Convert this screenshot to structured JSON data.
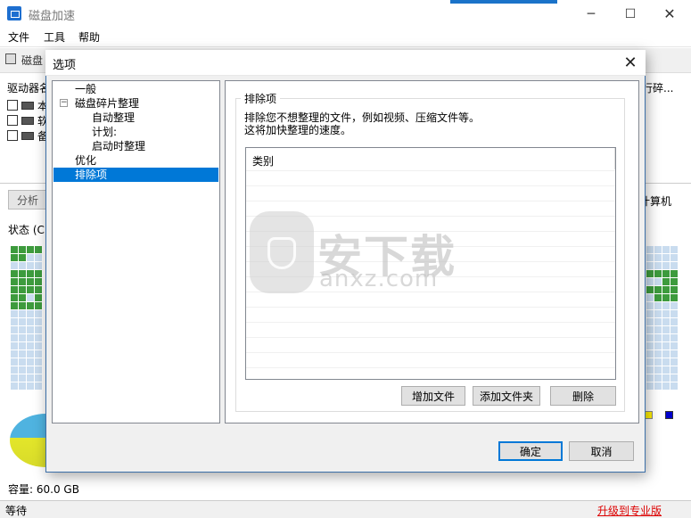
{
  "window": {
    "title": "磁盘加速",
    "controls": {
      "minimize": "─",
      "maximize": "☐",
      "close": "✕"
    }
  },
  "menu": [
    "文件",
    "工具",
    "帮助"
  ],
  "toolbar": {
    "label": "磁盘"
  },
  "main": {
    "drive_header": "驱动器名",
    "drive_header_right": "行碎...",
    "drives": [
      "本",
      "软",
      "备"
    ],
    "analyze_button": "分析",
    "computer_label": "计算机",
    "status_label": "状态 (C:",
    "capacity": "容量: 60.0 GB"
  },
  "statusbar": {
    "status": "等待",
    "upgrade": "升级到专业版"
  },
  "dialog": {
    "title": "选项",
    "close": "✕",
    "tree": {
      "expander": "−",
      "items": [
        {
          "label": "一般"
        },
        {
          "label": "磁盘碎片整理"
        },
        {
          "label": "自动整理"
        },
        {
          "label": "计划:"
        },
        {
          "label": "启动时整理"
        },
        {
          "label": "优化"
        },
        {
          "label": "排除项"
        }
      ],
      "selected": "排除项"
    },
    "group_title": "排除项",
    "description_line1": "排除您不想整理的文件，例如视频、压缩文件等。",
    "description_line2": "这将加快整理的速度。",
    "list_header": "类别",
    "buttons": {
      "add_file": "增加文件",
      "add_folder": "添加文件夹",
      "delete": "删除",
      "ok": "确定",
      "cancel": "取消"
    }
  },
  "watermark": {
    "text": "安下载",
    "sub": "anxz.com"
  },
  "colors": {
    "accent": "#0078d7",
    "upgrade": "#dd0000",
    "cluster_used": "#3d9b3d",
    "cluster_free": "#c9dcef"
  }
}
